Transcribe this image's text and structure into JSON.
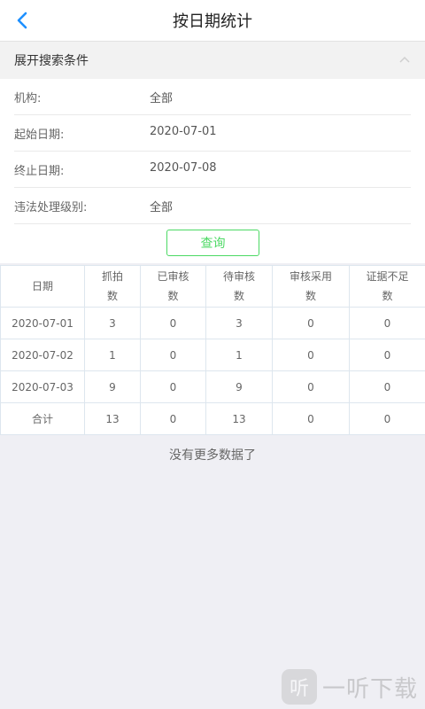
{
  "header": {
    "title": "按日期统计",
    "back_icon": "chevron-left-icon"
  },
  "search_panel": {
    "title": "展开搜索条件",
    "collapse_icon": "chevron-up-icon"
  },
  "form": {
    "rows": [
      {
        "label": "机构:",
        "value": "全部"
      },
      {
        "label": "起始日期:",
        "value": "2020-07-01"
      },
      {
        "label": "终止日期:",
        "value": "2020-07-08"
      },
      {
        "label": "违法处理级别:",
        "value": "全部"
      }
    ],
    "query_label": "查询"
  },
  "table": {
    "headers": [
      [
        "日期"
      ],
      [
        "抓拍",
        "数"
      ],
      [
        "已审核",
        "数"
      ],
      [
        "待审核",
        "数"
      ],
      [
        "审核采用",
        "数"
      ],
      [
        "证据不足",
        "数"
      ]
    ],
    "rows": [
      [
        "2020-07-01",
        "3",
        "0",
        "3",
        "0",
        "0"
      ],
      [
        "2020-07-02",
        "1",
        "0",
        "1",
        "0",
        "0"
      ],
      [
        "2020-07-03",
        "9",
        "0",
        "9",
        "0",
        "0"
      ],
      [
        "合计",
        "13",
        "0",
        "13",
        "0",
        "0"
      ]
    ]
  },
  "footer": {
    "no_more": "没有更多数据了"
  },
  "watermark": {
    "logo_text": "听",
    "text": "一听下载"
  },
  "colors": {
    "accent_blue": "#1e90ff",
    "accent_green": "#4cd964"
  }
}
